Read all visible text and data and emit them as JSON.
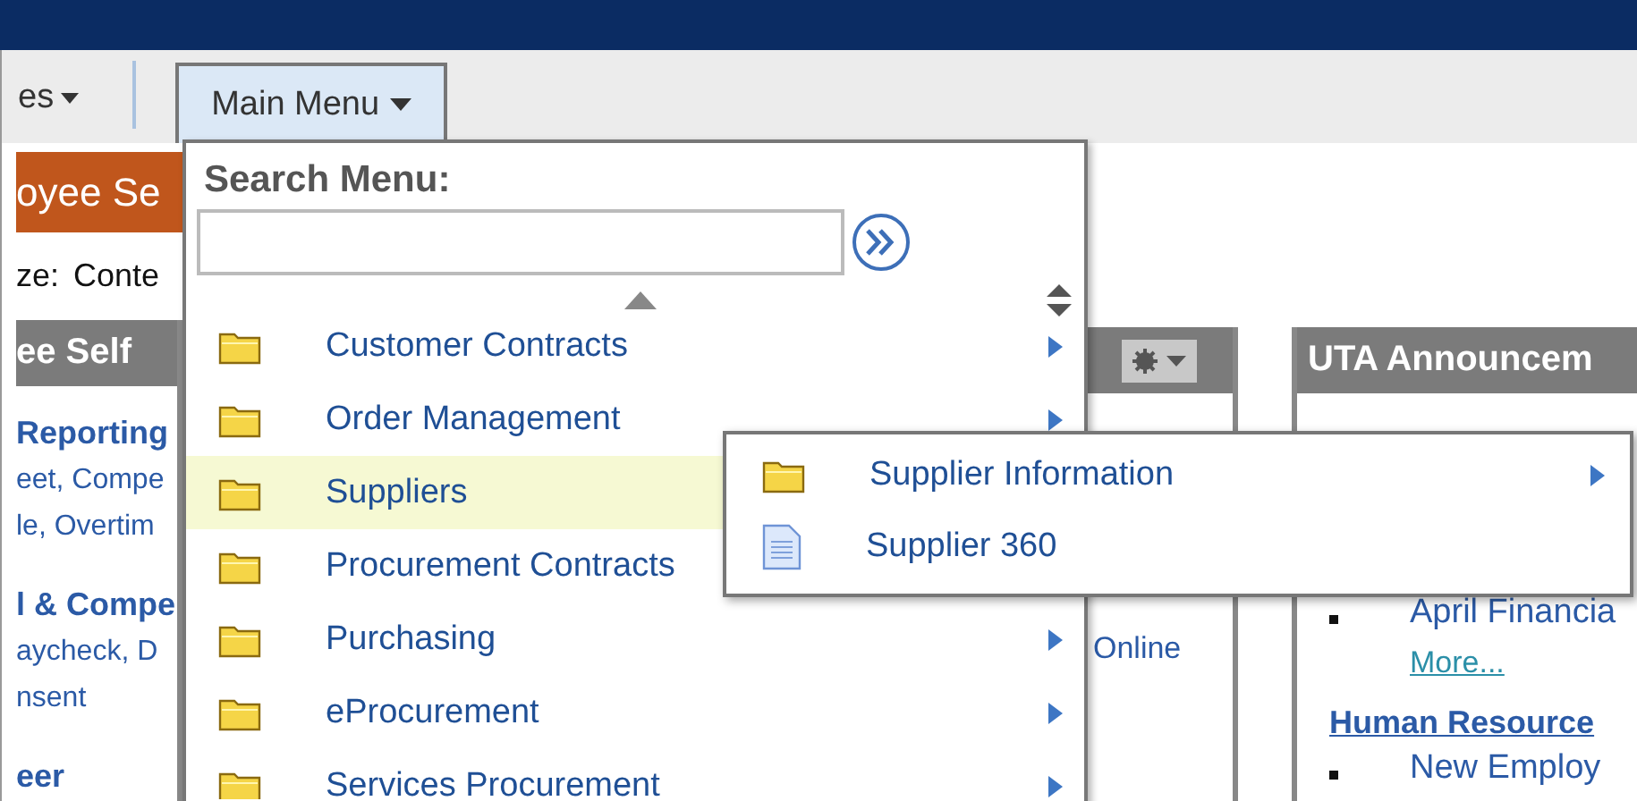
{
  "nav": {
    "partial_tab": "es",
    "main_menu": {
      "label": "Main Menu",
      "expanded": true
    }
  },
  "left": {
    "banner": "oyee Se",
    "size_label": "ze:",
    "size_value": "Conte",
    "panel_title": "ee Self",
    "items": [
      {
        "kind": "heading",
        "text": "Reporting"
      },
      {
        "kind": "link",
        "text": "eet, Compe"
      },
      {
        "kind": "link",
        "text": "le, Overtim"
      },
      {
        "kind": "heading",
        "text": "l & Compe"
      },
      {
        "kind": "link",
        "text": "aycheck, D"
      },
      {
        "kind": "link",
        "text": "nsent"
      },
      {
        "kind": "heading",
        "text": "eer"
      }
    ]
  },
  "middle": {
    "line": "Online"
  },
  "right": {
    "title": "UTA Announcem",
    "items": [
      {
        "kind": "bullet",
        "text": "April Financia"
      },
      {
        "kind": "more",
        "text": "More..."
      },
      {
        "kind": "section",
        "text": "Human Resource"
      },
      {
        "kind": "bullet",
        "text": "New Employ"
      }
    ]
  },
  "menu": {
    "search_label": "Search Menu:",
    "items": [
      {
        "label": "Customer Contracts",
        "kind": "folder",
        "selected": false,
        "arrow": true
      },
      {
        "label": "Order Management",
        "kind": "folder",
        "selected": false,
        "arrow": true
      },
      {
        "label": "Suppliers",
        "kind": "folder",
        "selected": true
      },
      {
        "label": "Procurement Contracts",
        "kind": "folder",
        "selected": false
      },
      {
        "label": "Purchasing",
        "kind": "folder",
        "selected": false,
        "arrow": true
      },
      {
        "label": "eProcurement",
        "kind": "folder",
        "selected": false,
        "arrow": true
      },
      {
        "label": "Services Procurement",
        "kind": "folder",
        "selected": false,
        "arrow": true
      }
    ]
  },
  "submenu": {
    "items": [
      {
        "label": "Supplier Information",
        "kind": "folder"
      },
      {
        "label": "Supplier 360",
        "kind": "page"
      }
    ]
  }
}
